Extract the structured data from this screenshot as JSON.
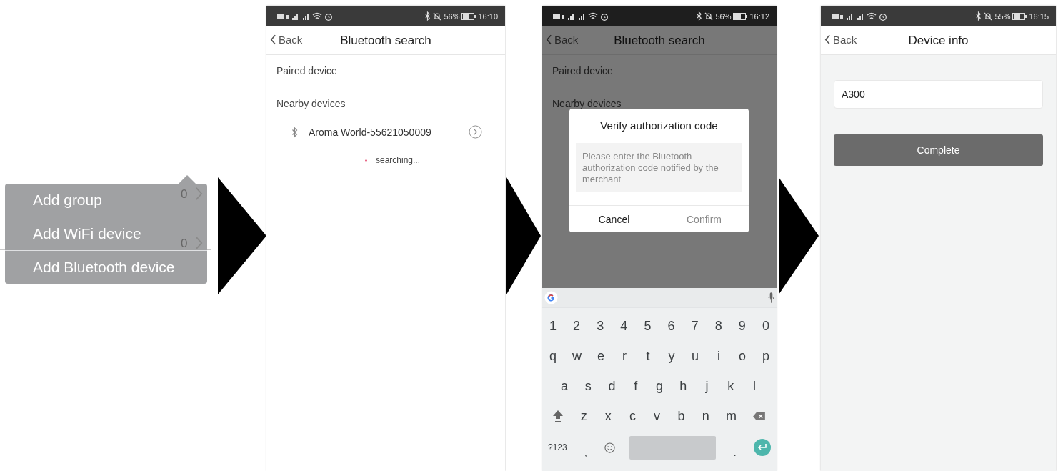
{
  "menu": {
    "items": [
      {
        "label": "Add group",
        "count": "0"
      },
      {
        "label": "Add WiFi device",
        "count": "0"
      },
      {
        "label": "Add Bluetooth device"
      }
    ]
  },
  "screens": [
    {
      "kind": "search",
      "status": {
        "battery": "56%",
        "time": "16:10"
      },
      "back": "Back",
      "title": "Bluetooth search",
      "paired_label": "Paired device",
      "nearby_label": "Nearby devices",
      "devices": [
        {
          "name": "Aroma World-55621050009"
        }
      ],
      "searching": "searching..."
    },
    {
      "kind": "auth",
      "status": {
        "battery": "56%",
        "time": "16:12"
      },
      "back": "Back",
      "title": "Bluetooth search",
      "paired_label": "Paired device",
      "nearby_label": "Nearby devices",
      "dialog": {
        "title": "Verify authorization code",
        "placeholder": "Please enter the Bluetooth authorization code notified by the merchant",
        "buttons": [
          {
            "label": "Cancel",
            "disabled": false
          },
          {
            "label": "Confirm",
            "disabled": true
          }
        ]
      },
      "keyboard": {
        "rows": [
          [
            "1",
            "2",
            "3",
            "4",
            "5",
            "6",
            "7",
            "8",
            "9",
            "0"
          ],
          [
            "q",
            "w",
            "e",
            "r",
            "t",
            "y",
            "u",
            "i",
            "o",
            "p"
          ],
          [
            "a",
            "s",
            "d",
            "f",
            "g",
            "h",
            "j",
            "k",
            "l"
          ],
          [
            "z",
            "x",
            "c",
            "v",
            "b",
            "n",
            "m"
          ]
        ],
        "symbols_key": "?123",
        "comma": ",",
        "period": "."
      }
    },
    {
      "kind": "info",
      "status": {
        "battery": "55%",
        "time": "16:15"
      },
      "back": "Back",
      "title": "Device info",
      "name_field": {
        "value": "A300"
      },
      "button": "Complete"
    }
  ]
}
